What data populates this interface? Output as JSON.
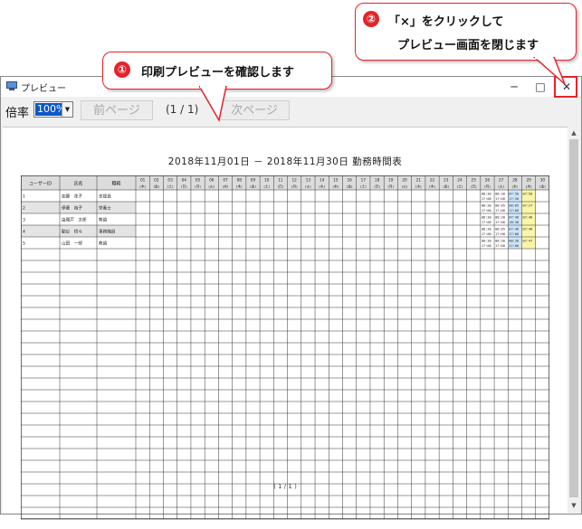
{
  "window": {
    "title": "プレビュー",
    "minimize": "─",
    "maximize": "□",
    "close": "✕"
  },
  "toolbar": {
    "zoom_label": "倍率",
    "zoom_value": "100%",
    "prev_label": "前ページ",
    "page_indicator": "(1 / 1)",
    "next_label": "次ページ"
  },
  "document": {
    "title": "2018年11月01日 － 2018年11月30日 勤務時間表",
    "footer_page": "( 1 / 1 )",
    "columns": {
      "user_id": "ユーザーID",
      "name": "氏名",
      "job": "職務"
    },
    "days": [
      {
        "d": "01",
        "w": "木"
      },
      {
        "d": "02",
        "w": "金"
      },
      {
        "d": "03",
        "w": "土"
      },
      {
        "d": "04",
        "w": "日"
      },
      {
        "d": "05",
        "w": "月"
      },
      {
        "d": "06",
        "w": "火"
      },
      {
        "d": "07",
        "w": "水"
      },
      {
        "d": "08",
        "w": "木"
      },
      {
        "d": "09",
        "w": "金"
      },
      {
        "d": "10",
        "w": "土"
      },
      {
        "d": "11",
        "w": "日"
      },
      {
        "d": "12",
        "w": "月"
      },
      {
        "d": "13",
        "w": "火"
      },
      {
        "d": "14",
        "w": "水"
      },
      {
        "d": "15",
        "w": "木"
      },
      {
        "d": "16",
        "w": "金"
      },
      {
        "d": "17",
        "w": "土"
      },
      {
        "d": "18",
        "w": "日"
      },
      {
        "d": "19",
        "w": "月"
      },
      {
        "d": "20",
        "w": "火"
      },
      {
        "d": "21",
        "w": "水"
      },
      {
        "d": "22",
        "w": "木"
      },
      {
        "d": "23",
        "w": "金"
      },
      {
        "d": "24",
        "w": "土"
      },
      {
        "d": "25",
        "w": "日"
      },
      {
        "d": "26",
        "w": "月"
      },
      {
        "d": "27",
        "w": "火"
      },
      {
        "d": "28",
        "w": "水"
      },
      {
        "d": "29",
        "w": "木"
      },
      {
        "d": "30",
        "w": "金"
      }
    ],
    "rows": [
      {
        "id": "1",
        "name": "加藤　花子",
        "job": "支援員",
        "cells": {
          "26": "08:30\n17:00",
          "27": "08:30\n17:00",
          "28": "07:50\n17:30",
          "29": "07:50\n"
        }
      },
      {
        "id": "2",
        "name": "伊藤　裕子",
        "job": "栄養士",
        "cells": {
          "26": "08:30\n17:00",
          "27": "08:05\n17:00",
          "28": "08:05\n17:00",
          "29": "07:27\n"
        }
      },
      {
        "id": "3",
        "name": "由理戸　太郎",
        "job": "教諭",
        "cells": {
          "26": "08:30\n17:00",
          "27": "08:30\n17:00",
          "28": "07:46\n18:30",
          "29": "07:46\n"
        }
      },
      {
        "id": "4",
        "name": "勤怠　悟斗",
        "job": "事務職員",
        "cells": {
          "26": "08:30\n17:00",
          "27": "08:05\n17:00",
          "28": "07:46\n17:00",
          "29": "07:46\n"
        }
      },
      {
        "id": "5",
        "name": "山田　一郎",
        "job": "教諭",
        "cells": {
          "26": "08:30\n17:00",
          "27": "08:30\n17:00",
          "28": "08:30\n17:00",
          "29": "07:47\n"
        }
      }
    ],
    "empty_rows": 23
  },
  "annotations": {
    "step1": {
      "num": "①",
      "text": "印刷プレビューを確認します"
    },
    "step2": {
      "num": "②",
      "line1": "「×」をクリックして",
      "line2": "プレビュー画面を閉じます"
    }
  },
  "colors": {
    "accent": "#e5232b",
    "highlight_blue": "#cfe6fb",
    "highlight_yellow": "#fbf5a8",
    "row_shade": "#e4e4e4"
  }
}
